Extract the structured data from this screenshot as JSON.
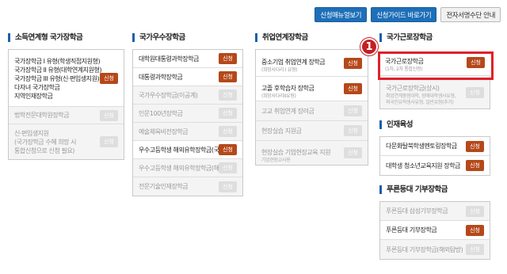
{
  "top_buttons": {
    "menu_guide": "신청매뉴얼보기",
    "quick_guide": "신청가이드 바로가기",
    "e_sign": "전자서명수단 안내"
  },
  "columns": {
    "income": {
      "title": "소득연계형 국가장학금",
      "group_lines": [
        "국가장학금 I 유형(학생직접지원형)",
        "국가장학금 II 유형(대학연계지원형)",
        "국가장학금 III 유형(신·편입생지원)",
        "다자녀 국가장학금",
        "지역인재장학금"
      ],
      "group_badge": "신청",
      "rows": [
        {
          "label": "법학전문대학원장학금",
          "badge": "신청"
        },
        {
          "label": "신·편입생지원",
          "note": "(국가장학금 수혜 희망 시",
          "note2": "통합신청으로 신청 필요)",
          "badge": "신청"
        }
      ]
    },
    "excellence": {
      "title": "국가우수장학금",
      "rows": [
        {
          "label": "대학원대통령과학장학금",
          "badge": "신청",
          "active": true
        },
        {
          "label": "대통령과학장학금",
          "badge": "신청",
          "active": true
        },
        {
          "label": "국가우수장학금(이공계)",
          "badge": "신청",
          "active": false
        },
        {
          "label": "인문100년장학금",
          "badge": "신청",
          "active": false
        },
        {
          "label": "예술체육비전장학금",
          "badge": "신청",
          "active": false
        },
        {
          "label": "우수고등학생 해외유학장학금(국내)",
          "badge": "신청",
          "active": true
        },
        {
          "label": "우수고등학생 해외유학장학금(해외)",
          "badge": "신청",
          "active": false
        },
        {
          "label": "전문기술인재장학금",
          "badge": "신청",
          "active": false
        }
      ]
    },
    "employment": {
      "title": "취업연계장학금",
      "rows": [
        {
          "label": "중소기업 취업연계 장학금",
          "sub": "(희망사다리 I 유형)",
          "badge": "신청",
          "active": true
        },
        {
          "label": "고졸 후학습자 장학금",
          "sub": "(희망사다리II유형)",
          "badge": "신청",
          "active": true
        },
        {
          "label": "고교 취업연계 장려금",
          "badge": "신청",
          "active": false
        },
        {
          "label": "현장실습 지원금",
          "badge": "신청",
          "active": false
        },
        {
          "label": "현장실습 기업현장교육 지원",
          "sub": "기업현장교사용",
          "badge": "신청",
          "active": false
        }
      ]
    },
    "work": {
      "title": "국가근로장학금",
      "marker": "1",
      "rows": [
        {
          "label": "국가근로장학금",
          "sub": "(1차, 2차 통합신청)",
          "badge": "신청",
          "active": true
        },
        {
          "label": "국가근로장학금(상시)",
          "sub": "취업연계중점대학, 장애대학생사유형,",
          "sub2": "외국인유학생사유형, 일반유형(추가)",
          "badge": "신청",
          "active": false
        }
      ]
    },
    "talent": {
      "title": "인재육성",
      "rows": [
        {
          "label": "다문화탈북학생멘토링장학금",
          "badge": "신청",
          "active": true
        },
        {
          "label": "대학생 청소년교육지원 장학금",
          "badge": "신청",
          "active": true
        }
      ]
    },
    "dream": {
      "title": "푸른등대 기부장학금",
      "rows": [
        {
          "label": "푸른등대 삼성기부장학금",
          "badge": "신청",
          "active": false
        },
        {
          "label": "푸른등대 기부장학금",
          "badge": "신청",
          "active": true
        },
        {
          "label": "푸른등대 기부장학금(해외탐방)",
          "badge": "신청",
          "active": false
        }
      ]
    }
  },
  "colors": {
    "primary": "#1e6fb8",
    "badge_active": "#b5481a",
    "badge_inactive": "#dedede",
    "highlight": "#e0202a",
    "note_red": "#e0402a"
  }
}
